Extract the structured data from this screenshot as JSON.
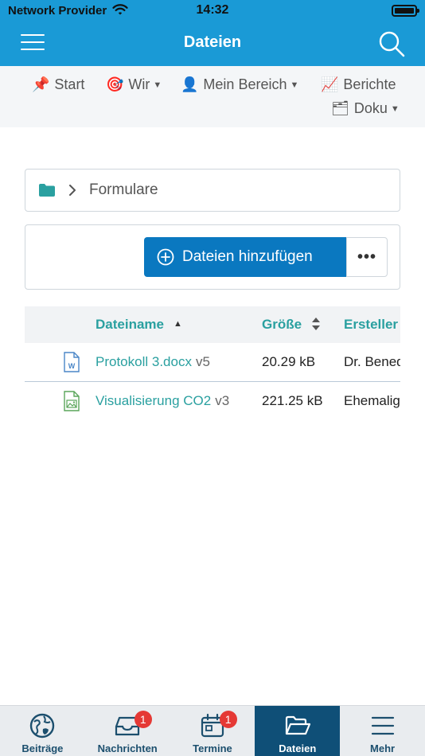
{
  "status_bar": {
    "provider": "Network Provider",
    "time": "14:32"
  },
  "navbar": {
    "title": "Dateien"
  },
  "subnav": {
    "items": [
      {
        "emoji": "📌",
        "label": "Start"
      },
      {
        "emoji": "🎯",
        "label": "Wir",
        "dropdown": true
      },
      {
        "emoji": "👤",
        "label": "Mein Bereich",
        "dropdown": true
      },
      {
        "emoji": "📈",
        "label": "Berichte"
      },
      {
        "emoji": "🗂",
        "label": "Doku",
        "dropdown": true
      }
    ],
    "caret": "▼"
  },
  "breadcrumb": {
    "current": "Formulare"
  },
  "actions": {
    "add_label": "Dateien hinzufügen",
    "more_label": "•••"
  },
  "table": {
    "columns": {
      "name": "Dateiname",
      "size": "Größe",
      "creator": "Ersteller"
    },
    "sort_up": "▲",
    "rows": [
      {
        "name": "Protokoll 3.docx",
        "version": "v5",
        "size": "20.29 kB",
        "creator": "Dr. Benedikt",
        "icon": "word-file-icon"
      },
      {
        "name": "Visualisierung CO2",
        "version": "v3",
        "size": "221.25 kB",
        "creator": "Ehemaliger",
        "icon": "image-file-icon"
      }
    ]
  },
  "tabbar": {
    "tabs": [
      {
        "label": "Beiträge",
        "icon": "globe-icon",
        "badge": ""
      },
      {
        "label": "Nachrichten",
        "icon": "inbox-icon",
        "badge": "1"
      },
      {
        "label": "Termine",
        "icon": "calendar-icon",
        "badge": "1"
      },
      {
        "label": "Dateien",
        "icon": "folder-open-icon",
        "badge": "",
        "active": true
      },
      {
        "label": "Mehr",
        "icon": "menu-icon",
        "badge": ""
      }
    ]
  },
  "colors": {
    "primary": "#1a9ad6",
    "button": "#0a78c0",
    "link": "#2aa0a0",
    "tab_active": "#0f4f77",
    "badge": "#e53935"
  }
}
